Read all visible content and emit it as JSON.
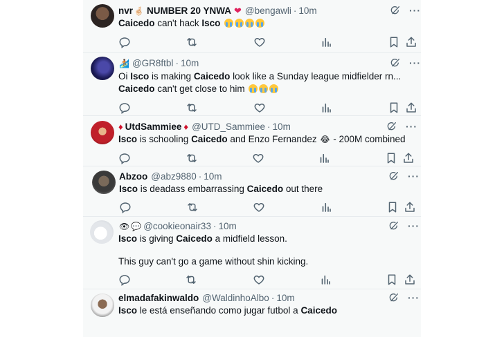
{
  "tweets": [
    {
      "name_prefix": "nvr",
      "name_main": "NUMBER 20 YNWA",
      "handle": "@bengawli",
      "time": "10m",
      "line1_parts": [
        "Caicedo",
        " can't hack ",
        "Isco"
      ],
      "line2": ""
    },
    {
      "name_prefix": "",
      "name_main": "",
      "handle": "@GR8ftbl",
      "time": "10m",
      "line1_parts": [
        "Oi ",
        "Isco",
        " is making ",
        "Caicedo",
        " look like a Sunday league midfielder rn..."
      ],
      "line2_parts": [
        "Caicedo",
        " can't get close to him"
      ]
    },
    {
      "name_prefix": "",
      "name_main": "UtdSammiee",
      "handle": "@UTD_Sammiee",
      "time": "10m",
      "line1_parts": [
        "Isco",
        " is schooling ",
        "Caicedo",
        " and Enzo Fernandez",
        " - 200M combined"
      ]
    },
    {
      "name_main": "Abzoo",
      "handle": "@abz9880",
      "time": "10m",
      "line1_parts": [
        "Isco",
        " is deadass embarrassing ",
        "Caicedo",
        " out there"
      ]
    },
    {
      "name_main": "",
      "handle": "@cookieonair33",
      "time": "10m",
      "line1_parts": [
        "Isco",
        " is giving ",
        "Caicedo",
        " a midfield lesson."
      ],
      "line2": "This guy can't go a game without shin kicking."
    },
    {
      "name_main": "elmadafakinwaldo",
      "handle": "@WaldinhoAlbo",
      "time": "10m",
      "line1_parts": [
        "Isco",
        " le está enseñando como jugar futbol a ",
        "Caicedo"
      ]
    }
  ],
  "separator": "·",
  "icons": {
    "reply": "reply-icon",
    "retweet": "retweet-icon",
    "like": "heart-icon",
    "views": "views-icon",
    "bookmark": "bookmark-icon",
    "share": "share-icon",
    "grok": "grok-icon",
    "more": "more-icon"
  }
}
